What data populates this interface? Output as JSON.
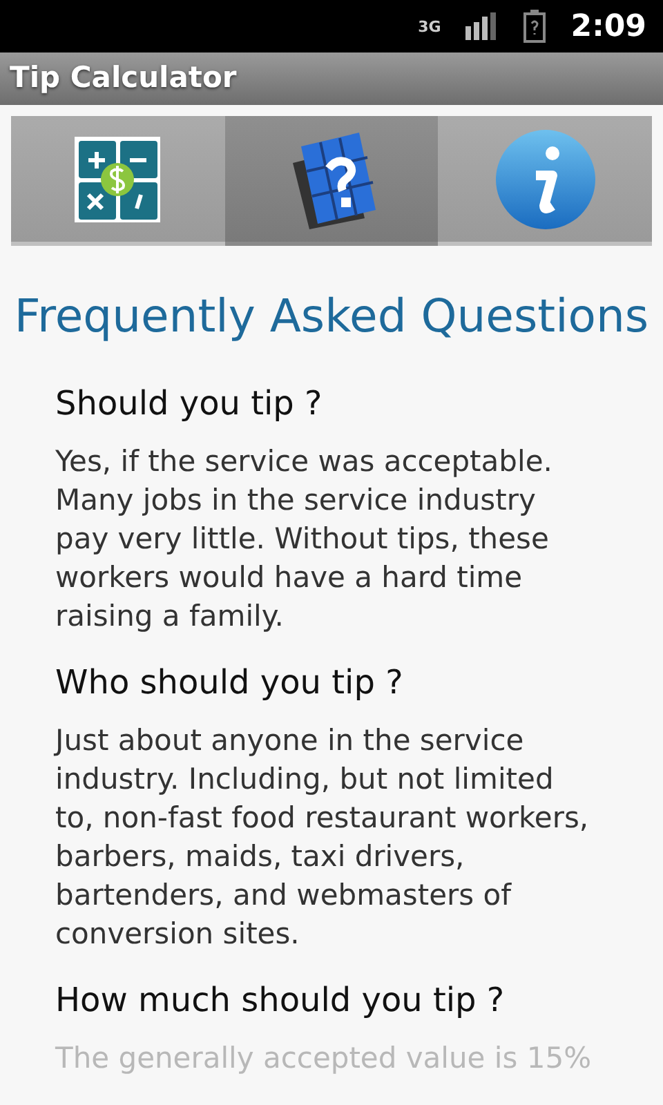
{
  "status_bar": {
    "network": "3G",
    "time": "2:09"
  },
  "app_bar": {
    "title": "Tip Calculator"
  },
  "tabs": [
    {
      "kind": "calculator",
      "selected": false
    },
    {
      "kind": "faq",
      "selected": true
    },
    {
      "kind": "info",
      "selected": false
    }
  ],
  "heading": "Frequently Asked Questions",
  "faq": [
    {
      "question": "Should you tip ?",
      "answer": "Yes, if the service was acceptable. Many jobs in the service industry pay very little. Without tips, these workers would have a hard time raising a family."
    },
    {
      "question": "Who should you tip ?",
      "answer": "Just about anyone in the service industry. Including, but not limited to, non-fast food restaurant workers, barbers, maids, taxi drivers, bartenders, and webmasters of conversion sites."
    },
    {
      "question": "How much should you tip ?",
      "answer": "The generally accepted value is 15%",
      "faded": true
    }
  ]
}
